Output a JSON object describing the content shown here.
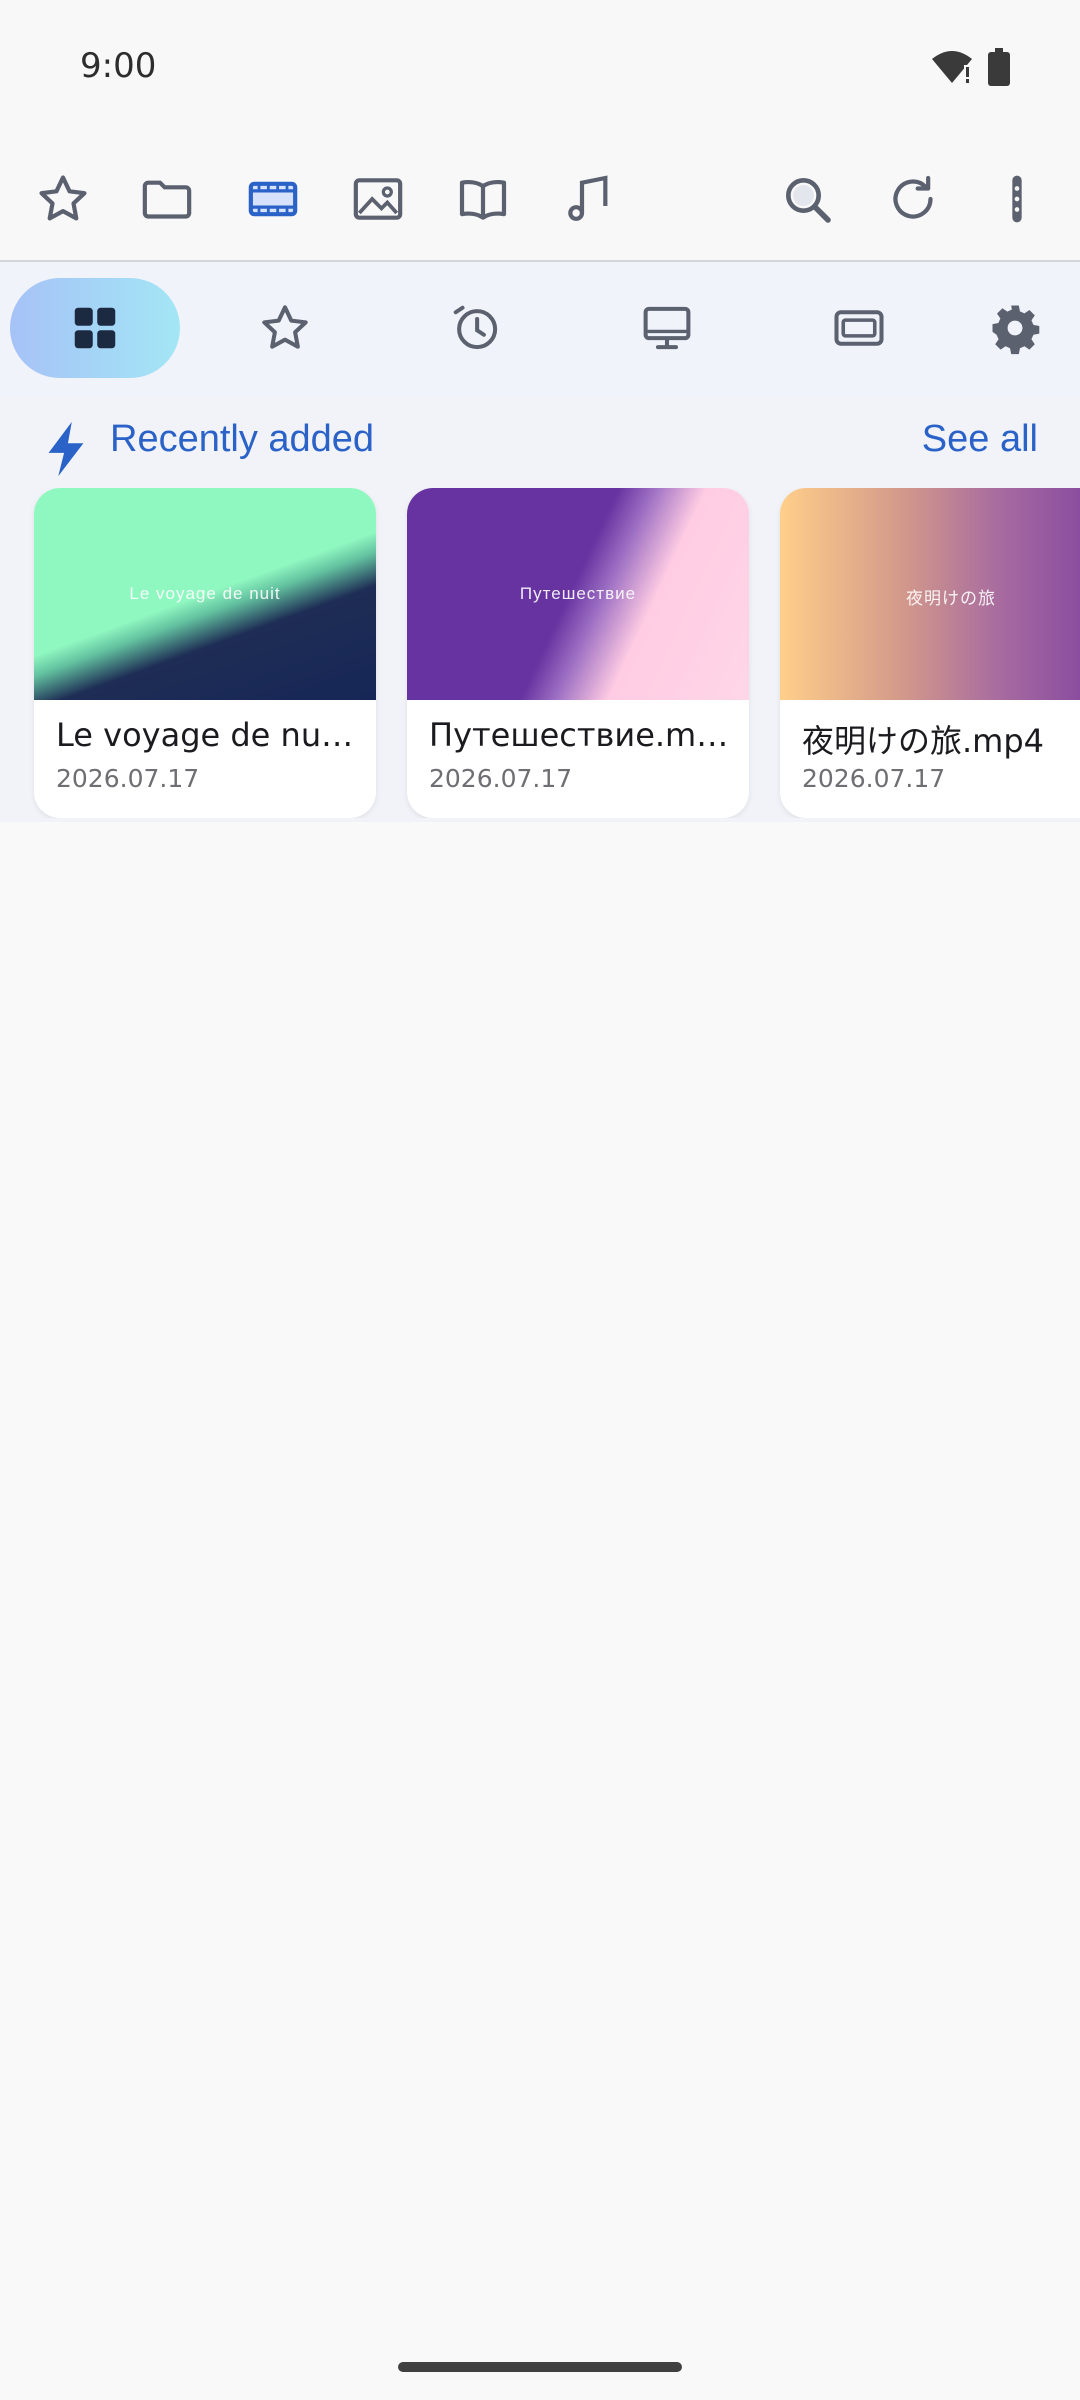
{
  "status_bar": {
    "time": "9:00"
  },
  "toolbar": {
    "icons": [
      "star-icon",
      "folder-icon",
      "video-icon",
      "image-icon",
      "book-icon",
      "music-icon",
      "search-icon",
      "refresh-icon",
      "more-vert-icon"
    ],
    "active": "video-icon"
  },
  "subnav": {
    "icons": [
      "grid-icon",
      "star-icon",
      "history-icon",
      "monitor-icon",
      "video-frame-icon",
      "settings-icon"
    ],
    "active": "grid-icon"
  },
  "recent": {
    "title": "Recently added",
    "see_all": "See all",
    "items": [
      {
        "title": "Le voyage de nuit…",
        "date": "2026.07.17",
        "thumb_text": "Le voyage de nuit"
      },
      {
        "title": "Путешествие.mp4",
        "date": "2026.07.17",
        "thumb_text": "Путешествие"
      },
      {
        "title": "夜明けの旅.mp4",
        "date": "2026.07.17",
        "thumb_text": "夜明けの旅"
      }
    ]
  },
  "colors": {
    "accent": "#2a62c8",
    "icon": "#5c6170"
  }
}
